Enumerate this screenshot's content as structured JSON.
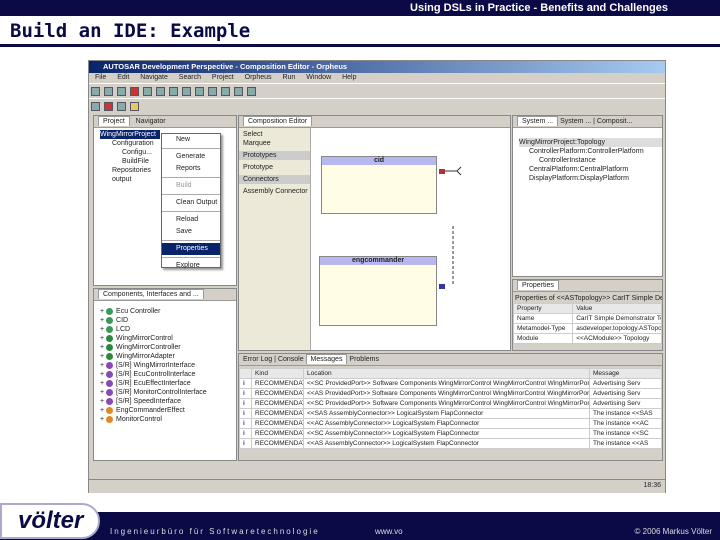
{
  "slide": {
    "header": "Using DSLs in Practice - Benefits and Challenges",
    "title": "Build an IDE: Example",
    "tagline": "Ingenieurbüro für Softwaretechnologie",
    "url": "www.vo",
    "copyright": "© 2006 Markus Völter",
    "logo": "völter"
  },
  "window": {
    "title": "AUTOSAR Development Perspective - Composition Editor - Orpheus",
    "menu": "File Edit Navigate Search Project Orpheus Run Window Help"
  },
  "project": {
    "tabs": [
      "Project",
      "Navigator"
    ],
    "tree": [
      "WingMirrorProject",
      "Configuration",
      "Configu...",
      "BuildFile",
      "Repositories",
      "output"
    ],
    "context_menu": [
      "New",
      "Generate",
      "Reports",
      "Build",
      "Clean Output",
      "Reload",
      "Save",
      "Properties",
      "Explore"
    ]
  },
  "components": {
    "tab": "Components, Interfaces and ...",
    "items": [
      {
        "label": "Ecu Controller",
        "color": "#3a9a5a"
      },
      {
        "label": "CID",
        "color": "#3a9a5a"
      },
      {
        "label": "LCD",
        "color": "#3a9a5a"
      },
      {
        "label": "WingMirrorControl",
        "color": "#2a8a3a"
      },
      {
        "label": "WingMirrorController",
        "color": "#2a8a3a"
      },
      {
        "label": "WingMirrorAdapter",
        "color": "#2a8a3a"
      },
      {
        "label": "[S/R] WingMirrorInterface",
        "color": "#8a4ab0"
      },
      {
        "label": "[S/R] EcuControlInterface",
        "color": "#8a4ab0"
      },
      {
        "label": "[S/R] EcuEffectInterface",
        "color": "#8a4ab0"
      },
      {
        "label": "[S/R] MonitorControlInterface",
        "color": "#8a4ab0"
      },
      {
        "label": "[S/R] SpeedInterface",
        "color": "#8a4ab0"
      },
      {
        "label": "EngCommanderEffect",
        "color": "#e08a20"
      },
      {
        "label": "MonitorControl",
        "color": "#e08a20"
      }
    ]
  },
  "editor": {
    "tab": "Composition Editor",
    "palette": [
      "Select",
      "Marquee",
      "Prototypes",
      "Prototype",
      "Connectors",
      "Assembly Connector"
    ],
    "components": [
      "cid",
      "engcommander"
    ]
  },
  "system": {
    "tabs": [
      "System ...",
      "System ...",
      "Composit..."
    ],
    "tree": [
      "WingMirrorProject:Topology",
      "ControllerPlatform:ControllerPlatform",
      "ControllerInstance",
      "CentralPlatform:CentralPlatform",
      "DisplayPlatform:DisplayPlatform"
    ]
  },
  "properties": {
    "tab": "Properties",
    "header": "Properties of <<ASTopology>> CarIT Simple Demonstrator",
    "columns": [
      "Property",
      "Value"
    ],
    "rows": [
      [
        "Name",
        "CarIT Simple Demonstrator Topology"
      ],
      [
        "Metamodel-Type",
        "asdeveloper.topology.ASTopology"
      ],
      [
        "Module",
        "<<ACModule>> Topology"
      ]
    ]
  },
  "messages": {
    "tabs": [
      "Error Log",
      "Console",
      "Messages",
      "Problems"
    ],
    "columns": [
      "Kind",
      "Location",
      "Message"
    ],
    "rows": [
      [
        "RECOMMENDATION",
        "<<SC ProvidedPort>> Software Components WingMirrorControl WingMirrorControl WingMirrorPort",
        "Advertising Serv"
      ],
      [
        "RECOMMENDATION",
        "<<AS ProvidedPort>> Software Components WingMirrorControl WingMirrorControl WingMirrorPort",
        "Advertising Serv"
      ],
      [
        "RECOMMENDATION",
        "<<SC ProvidedPort>> Software Components WingMirrorControl WingMirrorControl WingMirrorPort",
        "Advertising Serv"
      ],
      [
        "RECOMMENDATION",
        "<<SAS AssemblyConnector>> LogicalSystem FlapConnector",
        "The instance <<SAS"
      ],
      [
        "RECOMMENDATION",
        "<<AC AssemblyConnector>> LogicalSystem FlapConnector",
        "The instance <<AC"
      ],
      [
        "RECOMMENDATION",
        "<<SC AssemblyConnector>> LogicalSystem FlapConnector",
        "The instance <<SC"
      ],
      [
        "RECOMMENDATION",
        "<<AS AssemblyConnector>> LogicalSystem FlapConnector",
        "The instance <<AS"
      ]
    ]
  },
  "taskbar": {
    "clock": "18:36"
  }
}
